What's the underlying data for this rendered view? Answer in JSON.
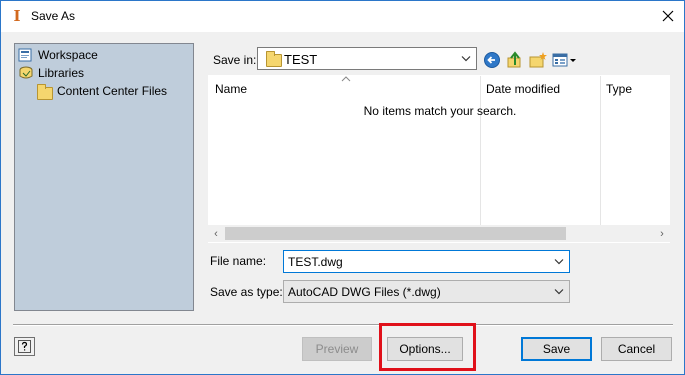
{
  "window": {
    "title": "Save As"
  },
  "places": [
    {
      "label": "Workspace",
      "icon": "workspace-icon"
    },
    {
      "label": "Libraries",
      "icon": "libraries-icon"
    },
    {
      "label": "Content Center Files",
      "icon": "folder-icon"
    }
  ],
  "save_in": {
    "label": "Save in:",
    "value": "TEST"
  },
  "file_list": {
    "columns": [
      "Name",
      "Date modified",
      "Type"
    ],
    "empty_message": "No items match your search."
  },
  "file_name": {
    "label": "File name:",
    "value": "TEST.dwg"
  },
  "save_as_type": {
    "label": "Save as type:",
    "value": "AutoCAD DWG Files (*.dwg)"
  },
  "buttons": {
    "preview": "Preview",
    "options": "Options...",
    "save": "Save",
    "cancel": "Cancel"
  },
  "colors": {
    "places_bg": "#bfcddb",
    "highlight": "#e0101a",
    "default_button_border": "#0078d7"
  }
}
